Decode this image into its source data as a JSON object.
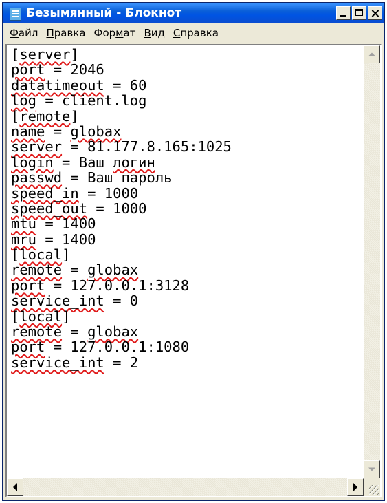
{
  "window": {
    "title": "Безымянный - Блокнот",
    "app_icon": "notepad-icon",
    "controls": [
      "minimize-icon",
      "maximize-icon",
      "close-icon"
    ]
  },
  "menu": {
    "items": [
      {
        "accel": "Ф",
        "rest": "айл",
        "suffix": ""
      },
      {
        "accel": "П",
        "rest": "равка",
        "suffix": ""
      },
      {
        "accel": "м",
        "rest": "ат",
        "prefix": "Фор"
      },
      {
        "accel": "В",
        "rest": "ид",
        "suffix": ""
      },
      {
        "accel": "С",
        "rest": "правка",
        "suffix": ""
      }
    ]
  },
  "editor": {
    "lines": [
      [
        [
          "[",
          0
        ],
        [
          "server",
          1
        ],
        [
          "]",
          0
        ]
      ],
      [
        [
          "port",
          1
        ],
        [
          " = 2046",
          0
        ]
      ],
      [
        [
          "datatimeout",
          1
        ],
        [
          " = 60",
          0
        ]
      ],
      [
        [
          "log",
          1
        ],
        [
          " = client.log",
          0
        ]
      ],
      [
        [
          "[",
          0
        ],
        [
          "remote",
          1
        ],
        [
          "]",
          0
        ]
      ],
      [
        [
          "name",
          1
        ],
        [
          " = ",
          0
        ],
        [
          "globax",
          1
        ]
      ],
      [
        [
          "server",
          1
        ],
        [
          " = 81.177.8.165:1025",
          0
        ]
      ],
      [
        [
          "login",
          1
        ],
        [
          " = Ваш ",
          0
        ],
        [
          "логин",
          1
        ]
      ],
      [
        [
          "passwd",
          1
        ],
        [
          " = Ваш пароль",
          0
        ]
      ],
      [
        [
          "speed_in",
          1
        ],
        [
          " = 1000",
          0
        ]
      ],
      [
        [
          "speed_out",
          1
        ],
        [
          " = 1000",
          0
        ]
      ],
      [
        [
          "mtu",
          1
        ],
        [
          " = 1400",
          0
        ]
      ],
      [
        [
          "mru",
          1
        ],
        [
          " = 1400",
          0
        ]
      ],
      [
        [
          "[",
          0
        ],
        [
          "local",
          1
        ],
        [
          "]",
          0
        ]
      ],
      [
        [
          "remote",
          1
        ],
        [
          " = ",
          0
        ],
        [
          "globax",
          1
        ]
      ],
      [
        [
          "port",
          1
        ],
        [
          " = 127.0.0.1:3128",
          0
        ]
      ],
      [
        [
          "service_int",
          1
        ],
        [
          " = 0",
          0
        ]
      ],
      [
        [
          "[",
          0
        ],
        [
          "local",
          1
        ],
        [
          "]",
          0
        ]
      ],
      [
        [
          "remote",
          1
        ],
        [
          " = ",
          0
        ],
        [
          "globax",
          1
        ]
      ],
      [
        [
          "port",
          1
        ],
        [
          " = 127.0.0.1:1080",
          0
        ]
      ],
      [
        [
          "service_int",
          1
        ],
        [
          " = 2",
          0
        ]
      ]
    ],
    "spellcheck_color": "#e01b1b"
  }
}
